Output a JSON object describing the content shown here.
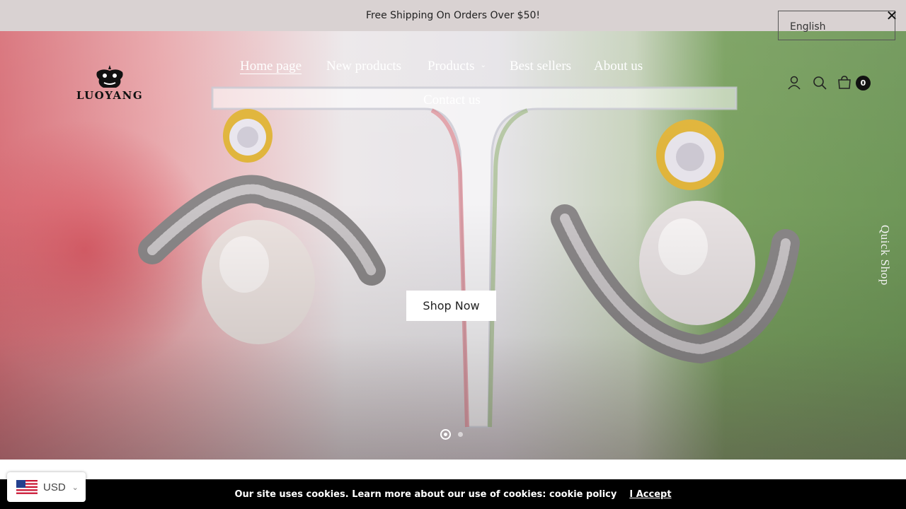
{
  "announcement": {
    "text": "Free Shipping On Orders Over $50!"
  },
  "language": {
    "selected": "English",
    "close_icon": "close-icon"
  },
  "logo": {
    "text": "LUOYANG"
  },
  "nav": {
    "items": [
      {
        "label": "Home page",
        "active": true
      },
      {
        "label": "New products"
      },
      {
        "label": "Products",
        "has_dropdown": true
      },
      {
        "label": "Best sellers"
      },
      {
        "label": "About us"
      },
      {
        "label": "Contact us"
      }
    ]
  },
  "header_icons": [
    "user-icon",
    "search-icon",
    "cart-icon"
  ],
  "cart": {
    "count": "0"
  },
  "hero": {
    "cta_label": "Shop Now",
    "quick_shop_label": "Quick Shop",
    "slides_total": 2,
    "active_slide": 1
  },
  "cookie_bar": {
    "message": "Our site uses cookies. Learn more about our use of cookies: cookie policy",
    "accept_label": "I Accept"
  },
  "currency": {
    "code": "USD",
    "flag_icon": "us-flag-icon"
  }
}
